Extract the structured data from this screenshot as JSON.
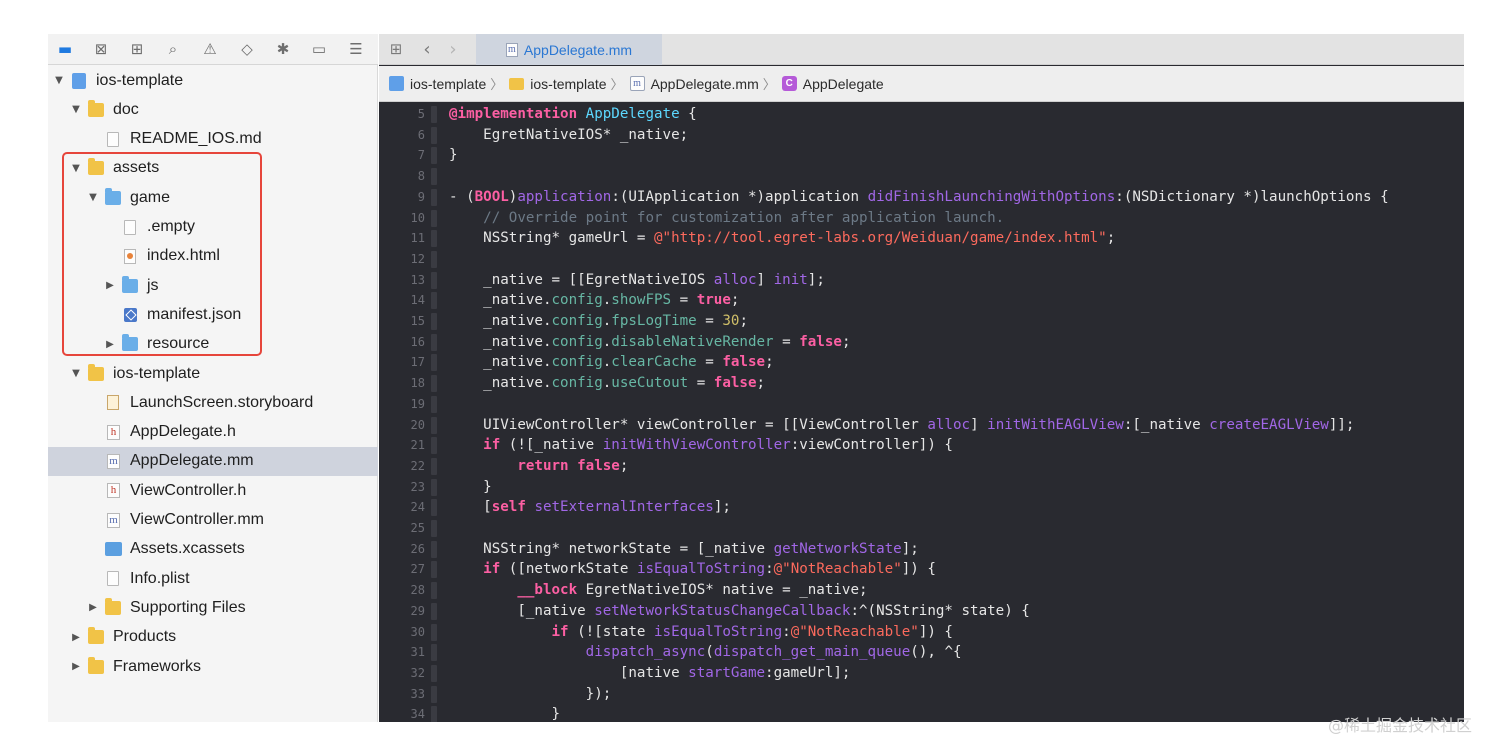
{
  "navigator": {
    "toolbar_icons": [
      "folder-icon",
      "source-control-icon",
      "hierarchy-icon",
      "search-icon",
      "warning-icon",
      "test-icon",
      "debug-icon",
      "breakpoint-icon",
      "report-icon"
    ],
    "tree": [
      {
        "label": "ios-template",
        "icon": "project",
        "disclosure": "▼",
        "depth": 0
      },
      {
        "label": "doc",
        "icon": "folder-yellow",
        "disclosure": "▼",
        "depth": 1
      },
      {
        "label": "README_IOS.md",
        "icon": "doc",
        "disclosure": "",
        "depth": 2
      },
      {
        "label": "assets",
        "icon": "folder-yellow",
        "disclosure": "▼",
        "depth": 1
      },
      {
        "label": "game",
        "icon": "folder-blue",
        "disclosure": "▼",
        "depth": 2
      },
      {
        "label": ".empty",
        "icon": "doc",
        "disclosure": "",
        "depth": 3
      },
      {
        "label": "index.html",
        "icon": "doc-html",
        "disclosure": "",
        "depth": 3
      },
      {
        "label": "js",
        "icon": "folder-blue",
        "disclosure": "▶",
        "depth": 3
      },
      {
        "label": "manifest.json",
        "icon": "doc-json",
        "disclosure": "",
        "depth": 3
      },
      {
        "label": "resource",
        "icon": "folder-blue",
        "disclosure": "▶",
        "depth": 3
      },
      {
        "label": "ios-template",
        "icon": "folder-yellow",
        "disclosure": "▼",
        "depth": 1
      },
      {
        "label": "LaunchScreen.storyboard",
        "icon": "storyboard",
        "disclosure": "",
        "depth": 2
      },
      {
        "label": "AppDelegate.h",
        "icon": "doc-h",
        "disclosure": "",
        "depth": 2
      },
      {
        "label": "AppDelegate.mm",
        "icon": "doc-m",
        "disclosure": "",
        "depth": 2,
        "selected": true
      },
      {
        "label": "ViewController.h",
        "icon": "doc-h",
        "disclosure": "",
        "depth": 2
      },
      {
        "label": "ViewController.mm",
        "icon": "doc-m",
        "disclosure": "",
        "depth": 2
      },
      {
        "label": "Assets.xcassets",
        "icon": "assets",
        "disclosure": "",
        "depth": 2
      },
      {
        "label": "Info.plist",
        "icon": "doc",
        "disclosure": "",
        "depth": 2
      },
      {
        "label": "Supporting Files",
        "icon": "folder-yellow",
        "disclosure": "▶",
        "depth": 2
      },
      {
        "label": "Products",
        "icon": "folder-yellow",
        "disclosure": "▶",
        "depth": 1
      },
      {
        "label": "Frameworks",
        "icon": "folder-yellow",
        "disclosure": "▶",
        "depth": 1
      }
    ],
    "highlight_color": "#e6453b",
    "selected_color": "#cfd3dd"
  },
  "tabbar": {
    "icons": [
      "grid-icon",
      "back-arrow-icon",
      "forward-arrow-icon"
    ],
    "active_tab": {
      "icon_letter": "m",
      "label": "AppDelegate.mm"
    }
  },
  "jumpbar": {
    "items": [
      {
        "label": "ios-template",
        "icon": "proj"
      },
      {
        "label": "ios-template",
        "icon": "folder"
      },
      {
        "label": "AppDelegate.mm",
        "icon": "file"
      },
      {
        "label": "AppDelegate",
        "icon": "cls"
      }
    ]
  },
  "code": {
    "lines": [
      {
        "n": "5",
        "t": [
          [
            "@implementation",
            "kw"
          ],
          [
            " ",
            "plain"
          ],
          [
            "AppDelegate",
            "cls"
          ],
          [
            " {",
            "plain"
          ]
        ]
      },
      {
        "n": "6",
        "t": [
          [
            "    EgretNativeIOS* _native;",
            "plain"
          ]
        ]
      },
      {
        "n": "7",
        "t": [
          [
            "}",
            "plain"
          ]
        ]
      },
      {
        "n": "8",
        "t": []
      },
      {
        "n": "9",
        "t": [
          [
            "- (",
            "plain"
          ],
          [
            "BOOL",
            "kw"
          ],
          [
            ")",
            "plain"
          ],
          [
            "application",
            "mt"
          ],
          [
            ":(UIApplication *)application ",
            "plain"
          ],
          [
            "didFinishLaunchingWithOptions",
            "mt"
          ],
          [
            ":(NSDictionary *)launchOptions {",
            "plain"
          ]
        ]
      },
      {
        "n": "10",
        "t": [
          [
            "    // Override point for customization after application launch.",
            "cmt"
          ]
        ]
      },
      {
        "n": "11",
        "t": [
          [
            "    NSString* gameUrl = ",
            "plain"
          ],
          [
            "@\"http://tool.egret-labs.org/Weiduan/game/index.html\"",
            "str"
          ],
          [
            ";",
            "plain"
          ]
        ]
      },
      {
        "n": "12",
        "t": []
      },
      {
        "n": "13",
        "t": [
          [
            "    _native = [[EgretNativeIOS ",
            "plain"
          ],
          [
            "alloc",
            "mt"
          ],
          [
            "] ",
            "plain"
          ],
          [
            "init",
            "mt"
          ],
          [
            "];",
            "plain"
          ]
        ]
      },
      {
        "n": "14",
        "t": [
          [
            "    _native.",
            "plain"
          ],
          [
            "config",
            "prop"
          ],
          [
            ".",
            "plain"
          ],
          [
            "showFPS",
            "prop"
          ],
          [
            " = ",
            "plain"
          ],
          [
            "true",
            "kw"
          ],
          [
            ";",
            "plain"
          ]
        ]
      },
      {
        "n": "15",
        "t": [
          [
            "    _native.",
            "plain"
          ],
          [
            "config",
            "prop"
          ],
          [
            ".",
            "plain"
          ],
          [
            "fpsLogTime",
            "prop"
          ],
          [
            " = ",
            "plain"
          ],
          [
            "30",
            "num"
          ],
          [
            ";",
            "plain"
          ]
        ]
      },
      {
        "n": "16",
        "t": [
          [
            "    _native.",
            "plain"
          ],
          [
            "config",
            "prop"
          ],
          [
            ".",
            "plain"
          ],
          [
            "disableNativeRender",
            "prop"
          ],
          [
            " = ",
            "plain"
          ],
          [
            "false",
            "kw"
          ],
          [
            ";",
            "plain"
          ]
        ]
      },
      {
        "n": "17",
        "t": [
          [
            "    _native.",
            "plain"
          ],
          [
            "config",
            "prop"
          ],
          [
            ".",
            "plain"
          ],
          [
            "clearCache",
            "prop"
          ],
          [
            " = ",
            "plain"
          ],
          [
            "false",
            "kw"
          ],
          [
            ";",
            "plain"
          ]
        ]
      },
      {
        "n": "18",
        "t": [
          [
            "    _native.",
            "plain"
          ],
          [
            "config",
            "prop"
          ],
          [
            ".",
            "plain"
          ],
          [
            "useCutout",
            "prop"
          ],
          [
            " = ",
            "plain"
          ],
          [
            "false",
            "kw"
          ],
          [
            ";",
            "plain"
          ]
        ]
      },
      {
        "n": "19",
        "t": []
      },
      {
        "n": "20",
        "t": [
          [
            "    UIViewController* viewController = [[ViewController ",
            "plain"
          ],
          [
            "alloc",
            "mt"
          ],
          [
            "] ",
            "plain"
          ],
          [
            "initWithEAGLView",
            "mt"
          ],
          [
            ":[_native ",
            "plain"
          ],
          [
            "createEAGLView",
            "mt"
          ],
          [
            "]];",
            "plain"
          ]
        ]
      },
      {
        "n": "21",
        "t": [
          [
            "    ",
            "plain"
          ],
          [
            "if",
            "kw"
          ],
          [
            " (![_native ",
            "plain"
          ],
          [
            "initWithViewController",
            "mt"
          ],
          [
            ":viewController]) {",
            "plain"
          ]
        ]
      },
      {
        "n": "22",
        "t": [
          [
            "        ",
            "plain"
          ],
          [
            "return",
            "kw"
          ],
          [
            " ",
            "plain"
          ],
          [
            "false",
            "kw"
          ],
          [
            ";",
            "plain"
          ]
        ]
      },
      {
        "n": "23",
        "t": [
          [
            "    }",
            "plain"
          ]
        ]
      },
      {
        "n": "24",
        "t": [
          [
            "    [",
            "plain"
          ],
          [
            "self",
            "kw"
          ],
          [
            " ",
            "plain"
          ],
          [
            "setExternalInterfaces",
            "mt"
          ],
          [
            "];",
            "plain"
          ]
        ]
      },
      {
        "n": "25",
        "t": []
      },
      {
        "n": "26",
        "t": [
          [
            "    NSString* networkState = [_native ",
            "plain"
          ],
          [
            "getNetworkState",
            "mt"
          ],
          [
            "];",
            "plain"
          ]
        ]
      },
      {
        "n": "27",
        "t": [
          [
            "    ",
            "plain"
          ],
          [
            "if",
            "kw"
          ],
          [
            " ([networkState ",
            "plain"
          ],
          [
            "isEqualToString",
            "mt"
          ],
          [
            ":",
            "plain"
          ],
          [
            "@\"NotReachable\"",
            "str"
          ],
          [
            "]) {",
            "plain"
          ]
        ]
      },
      {
        "n": "28",
        "t": [
          [
            "        ",
            "plain"
          ],
          [
            "__block",
            "kw"
          ],
          [
            " EgretNativeIOS* native = _native;",
            "plain"
          ]
        ]
      },
      {
        "n": "29",
        "t": [
          [
            "        [_native ",
            "plain"
          ],
          [
            "setNetworkStatusChangeCallback",
            "mt"
          ],
          [
            ":^(NSString* state) {",
            "plain"
          ]
        ]
      },
      {
        "n": "30",
        "t": [
          [
            "            ",
            "plain"
          ],
          [
            "if",
            "kw"
          ],
          [
            " (![state ",
            "plain"
          ],
          [
            "isEqualToString",
            "mt"
          ],
          [
            ":",
            "plain"
          ],
          [
            "@\"NotReachable\"",
            "str"
          ],
          [
            "]) {",
            "plain"
          ]
        ]
      },
      {
        "n": "31",
        "t": [
          [
            "                ",
            "plain"
          ],
          [
            "dispatch_async",
            "mt"
          ],
          [
            "(",
            "plain"
          ],
          [
            "dispatch_get_main_queue",
            "mt"
          ],
          [
            "(), ^{",
            "plain"
          ]
        ]
      },
      {
        "n": "32",
        "t": [
          [
            "                    [native ",
            "plain"
          ],
          [
            "startGame",
            "mt"
          ],
          [
            ":gameUrl];",
            "plain"
          ]
        ]
      },
      {
        "n": "33",
        "t": [
          [
            "                });",
            "plain"
          ]
        ]
      },
      {
        "n": "34",
        "t": [
          [
            "            }",
            "plain"
          ]
        ]
      }
    ]
  },
  "watermark": "@稀土掘金技术社区"
}
